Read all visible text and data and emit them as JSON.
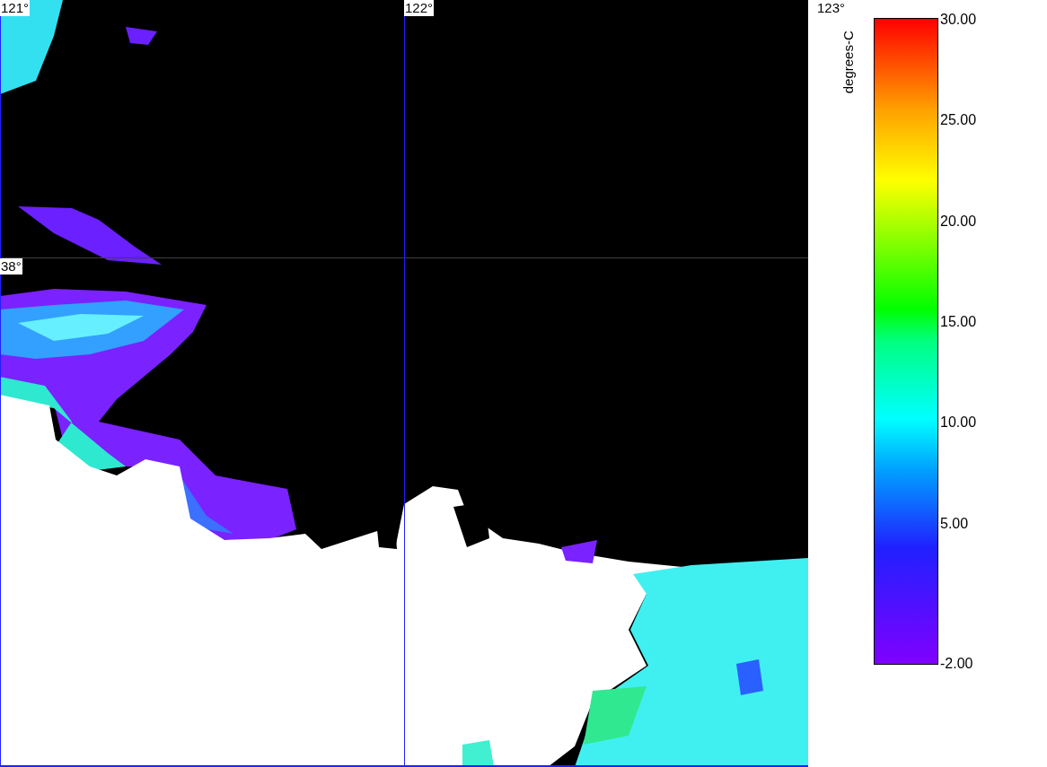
{
  "map": {
    "longitude_labels": [
      "121°",
      "122°",
      "123°"
    ],
    "latitude_labels": [
      "38°"
    ]
  },
  "colorbar": {
    "title": "degrees-C",
    "tick_labels": [
      "30.00",
      "25.00",
      "20.00",
      "15.00",
      "10.00",
      "5.00",
      "-2.00"
    ]
  }
}
